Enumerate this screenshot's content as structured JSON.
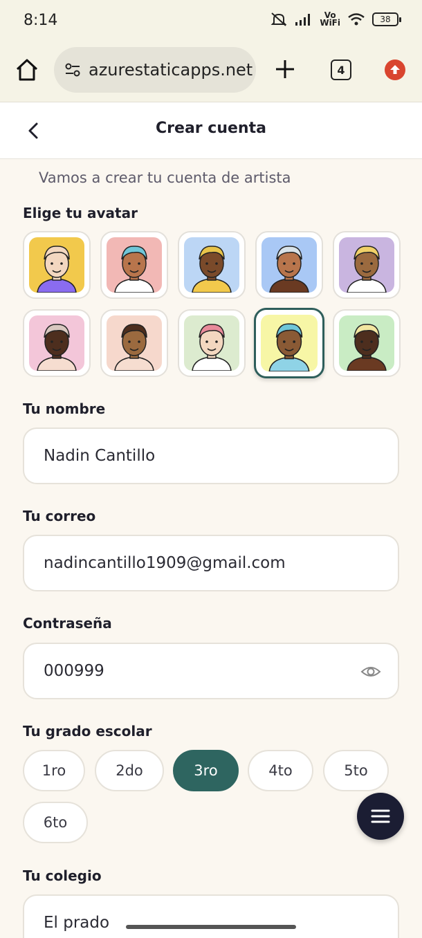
{
  "status": {
    "time": "8:14",
    "vowifi_line1": "Vo",
    "vowifi_line2": "WiFi",
    "battery": "38"
  },
  "browser": {
    "url": "azurestaticapps.net",
    "tab_count": "4"
  },
  "header": {
    "title": "Crear cuenta"
  },
  "subtitle": "Vamos a crear tu cuenta de artista",
  "avatar_section": {
    "label": "Elige tu avatar",
    "selected_index": 8,
    "avatars": [
      {
        "bg": "#f2c94c"
      },
      {
        "bg": "#f2b8b5"
      },
      {
        "bg": "#bcd6f5"
      },
      {
        "bg": "#a9c8f5"
      },
      {
        "bg": "#c9b5e0"
      },
      {
        "bg": "#f3c6d9"
      },
      {
        "bg": "#f6d8cc"
      },
      {
        "bg": "#dcebcf"
      },
      {
        "bg": "#f7f6a6"
      },
      {
        "bg": "#c9ecc4"
      }
    ]
  },
  "name_field": {
    "label": "Tu nombre",
    "value": "Nadin Cantillo"
  },
  "email_field": {
    "label": "Tu correo",
    "value": "nadincantillo1909@gmail.com"
  },
  "password_field": {
    "label": "Contraseña",
    "value": "000999"
  },
  "grade": {
    "label": "Tu grado escolar",
    "options": [
      "1ro",
      "2do",
      "3ro",
      "4to",
      "5to",
      "6to"
    ],
    "selected": "3ro"
  },
  "school_field": {
    "label": "Tu colegio",
    "value": "El prado"
  },
  "colors": {
    "accent": "#2e6560",
    "fab": "#1b1d33",
    "background": "#fbf7f0"
  }
}
